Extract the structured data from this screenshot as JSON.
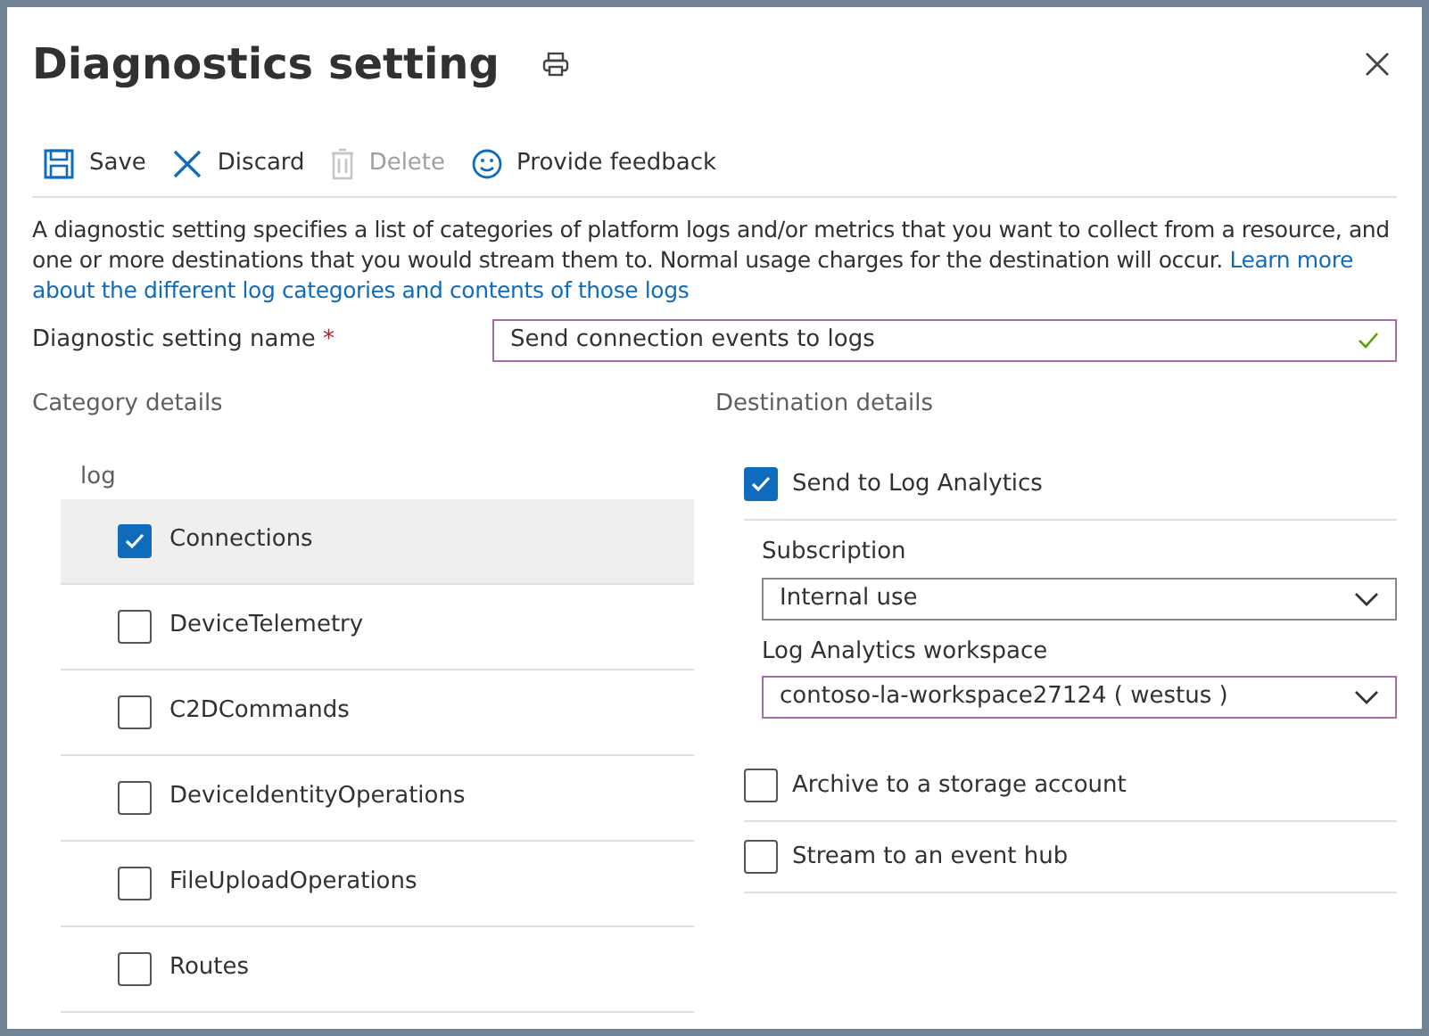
{
  "panel": {
    "title": "Diagnostics setting"
  },
  "toolbar": [
    {
      "kind": "save",
      "label": "Save",
      "disabled": false
    },
    {
      "kind": "discard",
      "label": "Discard",
      "disabled": false
    },
    {
      "kind": "delete",
      "label": "Delete",
      "disabled": true
    },
    {
      "kind": "feedback",
      "label": "Provide feedback",
      "disabled": false
    }
  ],
  "description": {
    "text": "A diagnostic setting specifies a list of categories of platform logs and/or metrics that you want to collect from a resource, and one or more destinations that you would stream them to. Normal usage charges for the destination will occur.",
    "link_parts": [
      "Learn more",
      "about the different log categories and contents of those logs"
    ]
  },
  "name_field": {
    "label": "Diagnostic setting name",
    "required_mark": "*",
    "value": "Send connection events to logs",
    "valid": true
  },
  "category_details": {
    "heading": "Category details",
    "group_label": "log",
    "items": [
      {
        "label": "Connections",
        "checked": true,
        "selected": true
      },
      {
        "label": "DeviceTelemetry",
        "checked": false,
        "selected": false
      },
      {
        "label": "C2DCommands",
        "checked": false,
        "selected": false
      },
      {
        "label": "DeviceIdentityOperations",
        "checked": false,
        "selected": false
      },
      {
        "label": "FileUploadOperations",
        "checked": false,
        "selected": false
      },
      {
        "label": "Routes",
        "checked": false,
        "selected": false
      }
    ]
  },
  "destination_details": {
    "heading": "Destination details",
    "items": [
      {
        "label": "Send to Log Analytics",
        "checked": true,
        "fields": [
          {
            "label": "Subscription",
            "value": "Internal use",
            "focused": false
          },
          {
            "label": "Log Analytics workspace",
            "value": "contoso-la-workspace27124 ( westus )",
            "focused": true
          }
        ]
      },
      {
        "label": "Archive to a storage account",
        "checked": false
      },
      {
        "label": "Stream to an event hub",
        "checked": false
      }
    ]
  }
}
